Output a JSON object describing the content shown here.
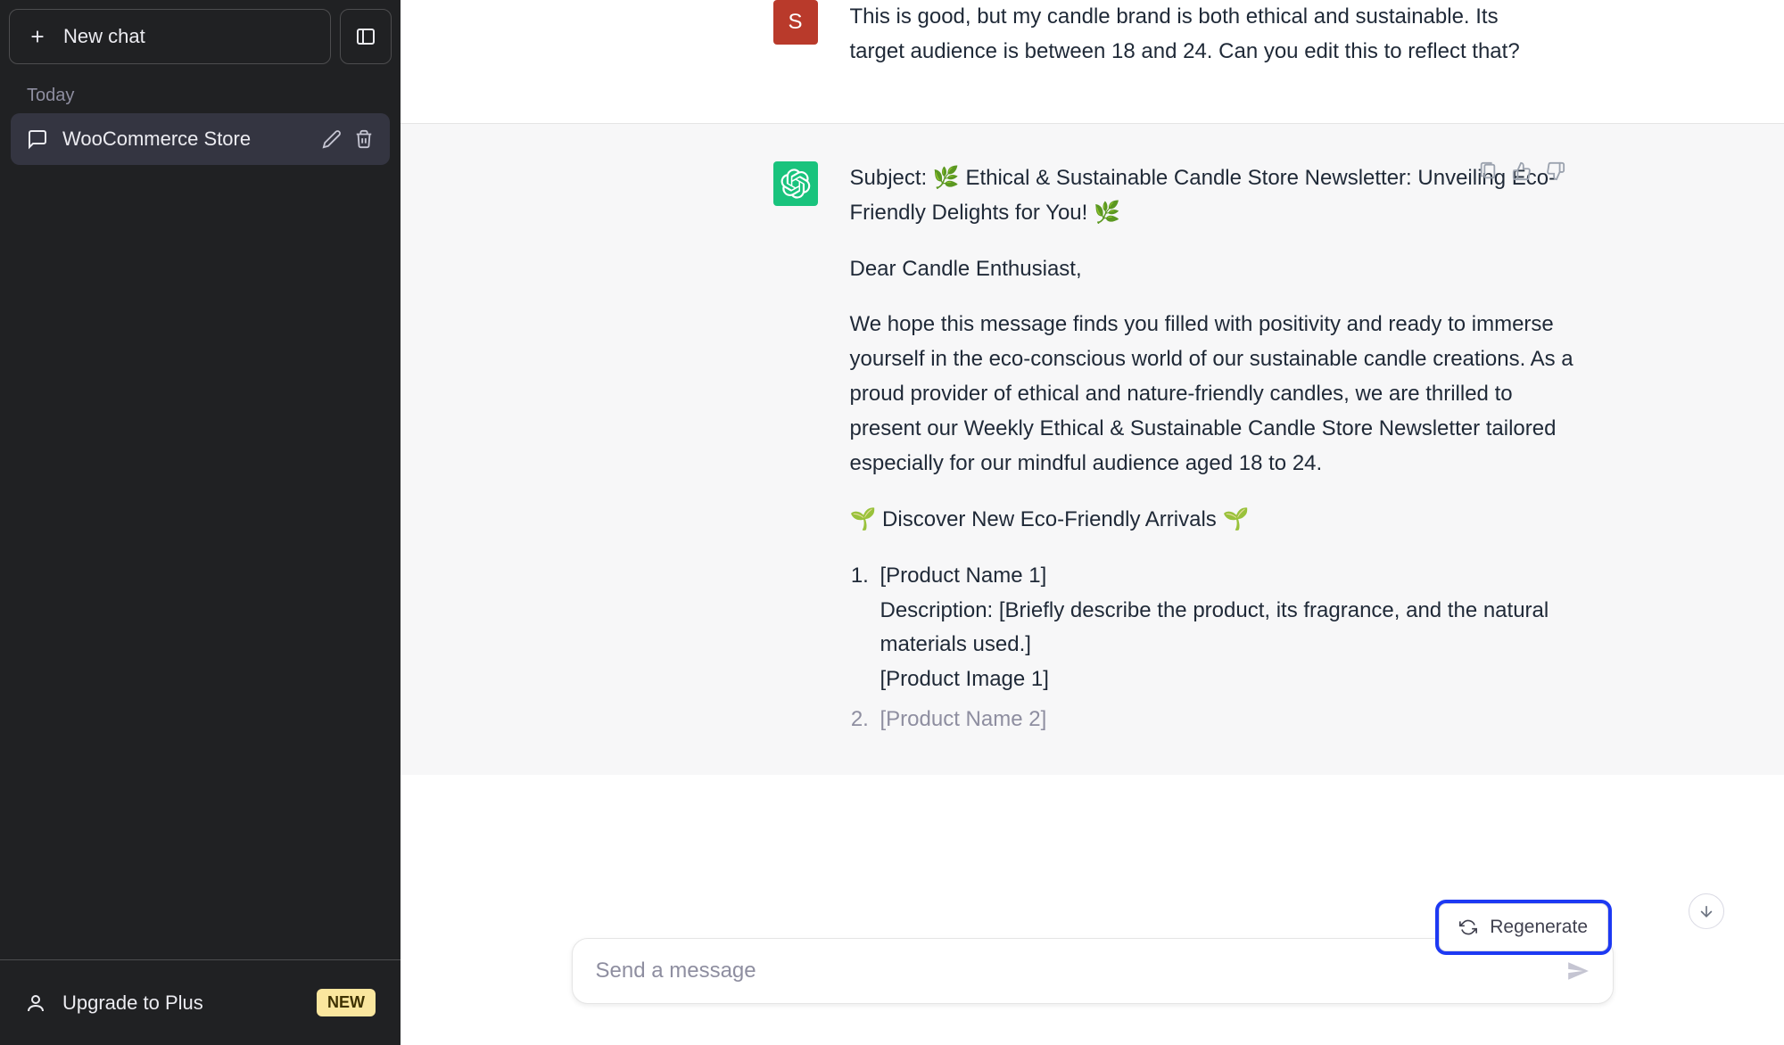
{
  "sidebar": {
    "new_chat_label": "New chat",
    "section_today": "Today",
    "chats": [
      {
        "title": "WooCommerce Store"
      }
    ],
    "upgrade_label": "Upgrade to Plus",
    "upgrade_badge": "NEW"
  },
  "conversation": {
    "user": {
      "avatar_letter": "S",
      "text": "This is good, but my candle brand is both ethical and sustainable. Its target audience is between 18 and 24. Can you edit this to reflect that?"
    },
    "assistant": {
      "subject_prefix": "Subject: ",
      "subject_text": "Ethical & Sustainable Candle Store Newsletter: Unveiling Eco-Friendly Delights for You!",
      "leaf_emoji": "🌿",
      "greeting": "Dear Candle Enthusiast,",
      "body1": "We hope this message finds you filled with positivity and ready to immerse yourself in the eco-conscious world of our sustainable candle creations. As a proud provider of ethical and nature-friendly candles, we are thrilled to present our Weekly Ethical & Sustainable Candle Store Newsletter tailored especially for our mindful audience aged 18 to 24.",
      "section_header": "🌱 Discover New Eco-Friendly Arrivals 🌱",
      "list": [
        {
          "name": "[Product Name 1]",
          "desc": "Description: [Briefly describe the product, its fragrance, and the natural materials used.]",
          "image": "[Product Image 1]"
        },
        {
          "name": "[Product Name 2]"
        }
      ]
    }
  },
  "actions": {
    "regenerate_label": "Regenerate"
  },
  "composer": {
    "placeholder": "Send a message"
  },
  "colors": {
    "highlight_outline": "#1D39F3"
  }
}
